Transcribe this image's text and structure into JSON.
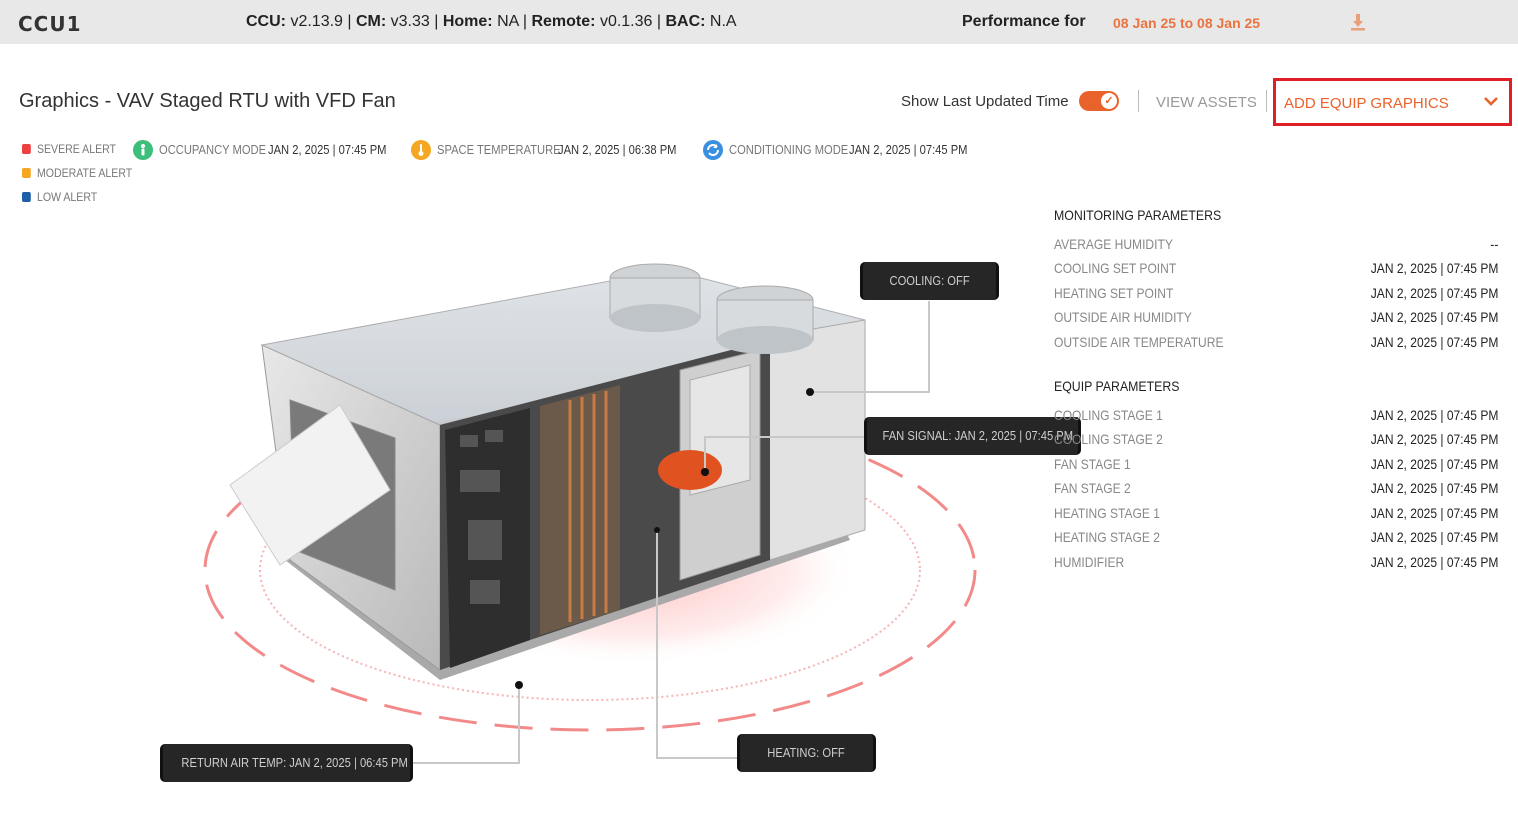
{
  "topbar": {
    "ccu_name": "CCU1",
    "versions": [
      {
        "label": "CCU:",
        "value": "v2.13.9"
      },
      {
        "label": "CM:",
        "value": "v3.33"
      },
      {
        "label": "Home:",
        "value": "NA"
      },
      {
        "label": "Remote:",
        "value": "v0.1.36"
      },
      {
        "label": "BAC:",
        "value": "N.A"
      }
    ],
    "separator": " | ",
    "performance_label": "Performance for",
    "performance_range": "08 Jan 25 to 08 Jan 25",
    "download_icon": "download-icon"
  },
  "header": {
    "title": "Graphics - VAV Staged RTU with VFD Fan",
    "toggle_label": "Show Last Updated Time",
    "toggle_on": true,
    "view_assets": "VIEW ASSETS",
    "add_equip": "ADD EQUIP GRAPHICS"
  },
  "legend": [
    {
      "label": "SEVERE ALERT",
      "color": "#ef4040"
    },
    {
      "label": "MODERATE ALERT",
      "color": "#f5a623"
    },
    {
      "label": "LOW ALERT",
      "color": "#1e5fa8"
    }
  ],
  "statuses": [
    {
      "label": "OCCUPANCY MODE",
      "time": "JAN 2, 2025 | 07:45 PM",
      "color": "#3bbf7a",
      "icon": "person-icon"
    },
    {
      "label": "SPACE TEMPERATURE",
      "time": "JAN 2, 2025 | 06:38 PM",
      "color": "#f5a623",
      "icon": "thermometer-icon"
    },
    {
      "label": "CONDITIONING MODE",
      "time": "JAN 2, 2025 | 07:45 PM",
      "color": "#3a8fe0",
      "icon": "cycle-icon"
    }
  ],
  "monitoring": {
    "title": "MONITORING PARAMETERS",
    "rows": [
      {
        "name": "AVERAGE HUMIDITY",
        "value": "--"
      },
      {
        "name": "COOLING SET POINT",
        "value": "JAN 2, 2025 | 07:45 PM"
      },
      {
        "name": "HEATING SET POINT",
        "value": "JAN 2, 2025 | 07:45 PM"
      },
      {
        "name": "OUTSIDE AIR HUMIDITY",
        "value": "JAN 2, 2025 | 07:45 PM"
      },
      {
        "name": "OUTSIDE AIR TEMPERATURE",
        "value": "JAN 2, 2025 | 07:45 PM"
      }
    ]
  },
  "equip": {
    "title": "EQUIP PARAMETERS",
    "rows": [
      {
        "name": "COOLING STAGE 1",
        "value": "JAN 2, 2025 | 07:45 PM"
      },
      {
        "name": "COOLING STAGE 2",
        "value": "JAN 2, 2025 | 07:45 PM"
      },
      {
        "name": "FAN STAGE 1",
        "value": "JAN 2, 2025 | 07:45 PM"
      },
      {
        "name": "FAN STAGE 2",
        "value": "JAN 2, 2025 | 07:45 PM"
      },
      {
        "name": "HEATING STAGE 1",
        "value": "JAN 2, 2025 | 07:45 PM"
      },
      {
        "name": "HEATING STAGE 2",
        "value": "JAN 2, 2025 | 07:45 PM"
      },
      {
        "name": "HUMIDIFIER",
        "value": "JAN 2, 2025 | 07:45 PM"
      }
    ]
  },
  "callouts": {
    "cooling": "COOLING: OFF",
    "fan_signal": "FAN SIGNAL: JAN 2, 2025 | 07:45 PM",
    "return_air": "RETURN AIR TEMP: JAN 2, 2025 | 06:45 PM",
    "heating": "HEATING: OFF"
  }
}
